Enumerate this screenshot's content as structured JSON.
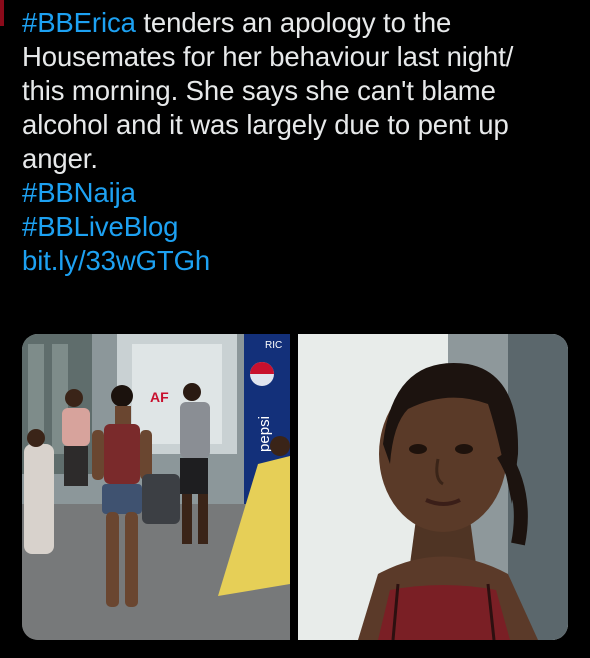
{
  "tweet": {
    "mention_hashtag": "#BBErica",
    "line1_rest": " tenders an apology to the",
    "line2": "Housemates for her behaviour last night/",
    "line3": "this morning. She says she can't blame",
    "line4": "alcohol and it was largely due to pent up",
    "line5": "anger.",
    "hashtag_naija": "#BBNaija",
    "hashtag_liveblog": "#BBLiveBlog",
    "link": "bit.ly/33wGTGh"
  },
  "media": {
    "left_photo": {
      "sign_text": "pepsi",
      "top_sign_text": "RIC"
    },
    "right_photo": {}
  },
  "colors": {
    "background": "#000000",
    "text": "#e7e9ea",
    "link": "#1da1f2",
    "edge_accent": "#8b0a1a"
  }
}
